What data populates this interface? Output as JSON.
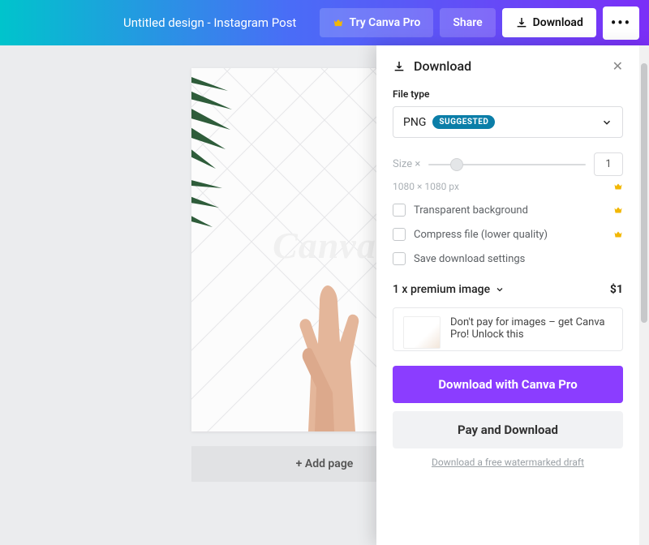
{
  "topbar": {
    "title": "Untitled design - Instagram Post",
    "tryPro": "Try Canva Pro",
    "share": "Share",
    "download": "Download",
    "more": "•••"
  },
  "canvas": {
    "watermark": "Canva",
    "addPage": "+ Add page"
  },
  "panel": {
    "title": "Download",
    "fileTypeLabel": "File type",
    "fileTypeValue": "PNG",
    "suggested": "SUGGESTED",
    "sizeLabel": "Size ×",
    "sizeValue": "1",
    "dimensions": "1080 × 1080 px",
    "transparent": "Transparent background",
    "compress": "Compress file (lower quality)",
    "saveSettings": "Save download settings",
    "premiumLine": "1 x premium image",
    "price": "$1",
    "promo": "Don't pay for images – get Canva Pro! Unlock this",
    "downloadPro": "Download with Canva Pro",
    "payDownload": "Pay and Download",
    "watermarkLink": "Download a free watermarked draft"
  }
}
